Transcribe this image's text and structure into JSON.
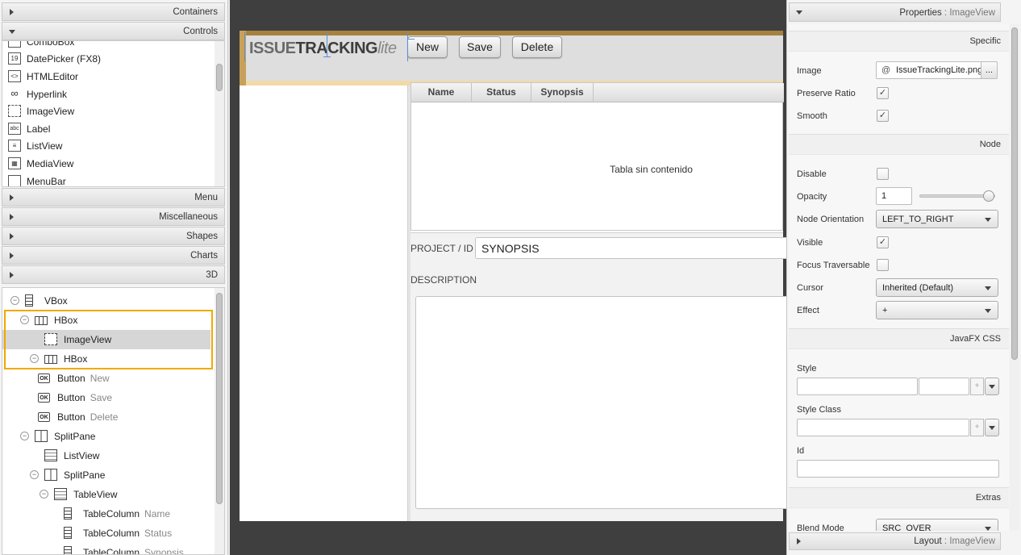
{
  "library": {
    "sections_top": [
      "Containers",
      "Controls"
    ],
    "items": [
      {
        "label": "ComboBox",
        "icon": "combobox-icon"
      },
      {
        "label": "DatePicker  (FX8)",
        "icon": "datepicker-icon",
        "glyph": "19"
      },
      {
        "label": "HTMLEditor",
        "icon": "htmleditor-icon",
        "glyph": "<>"
      },
      {
        "label": "Hyperlink",
        "icon": "hyperlink-icon",
        "glyph": "∞"
      },
      {
        "label": "ImageView",
        "icon": "imageview-icon",
        "glyph": ""
      },
      {
        "label": "Label",
        "icon": "label-icon",
        "glyph": "abc"
      },
      {
        "label": "ListView",
        "icon": "listview-icon",
        "glyph": "≡"
      },
      {
        "label": "MediaView",
        "icon": "mediaview-icon",
        "glyph": "▦"
      },
      {
        "label": "MenuBar",
        "icon": "menubar-icon",
        "glyph": ""
      }
    ],
    "sections_bottom": [
      "Menu",
      "Miscellaneous",
      "Shapes",
      "Charts",
      "3D"
    ]
  },
  "hierarchy": [
    {
      "type": "VBox",
      "sub": "",
      "depth": 0,
      "toggle": "−"
    },
    {
      "type": "HBox",
      "sub": "",
      "depth": 1,
      "toggle": "−"
    },
    {
      "type": "ImageView",
      "sub": "",
      "depth": 2,
      "toggle": ""
    },
    {
      "type": "HBox",
      "sub": "",
      "depth": 2,
      "toggle": "−"
    },
    {
      "type": "Button",
      "sub": "New",
      "depth": 3,
      "toggle": ""
    },
    {
      "type": "Button",
      "sub": "Save",
      "depth": 3,
      "toggle": ""
    },
    {
      "type": "Button",
      "sub": "Delete",
      "depth": 3,
      "toggle": ""
    },
    {
      "type": "SplitPane",
      "sub": "",
      "depth": 1,
      "toggle": "−"
    },
    {
      "type": "ListView",
      "sub": "",
      "depth": 2,
      "toggle": ""
    },
    {
      "type": "SplitPane",
      "sub": "",
      "depth": 2,
      "toggle": "−"
    },
    {
      "type": "TableView",
      "sub": "",
      "depth": 3,
      "toggle": "−"
    },
    {
      "type": "TableColumn",
      "sub": "Name",
      "depth": 4,
      "toggle": ""
    },
    {
      "type": "TableColumn",
      "sub": "Status",
      "depth": 4,
      "toggle": ""
    },
    {
      "type": "TableColumn",
      "sub": "Synopsis",
      "depth": 4,
      "toggle": ""
    }
  ],
  "canvas": {
    "logo": {
      "part1": "ISSUE",
      "part2": "TRACKING",
      "part3": "lite"
    },
    "buttons": [
      "New",
      "Save",
      "Delete"
    ],
    "columns": [
      "Name",
      "Status",
      "Synopsis"
    ],
    "empty_text": "Tabla sin contenido",
    "project_label": "PROJECT / ID",
    "synopsis_value": "SYNOPSIS",
    "description_label": "DESCRIPTION"
  },
  "properties": {
    "header": "Properties",
    "header_sub": " : ImageView",
    "footer": "Layout",
    "footer_sub": " : ImageView",
    "specific": "Specific",
    "image_label": "Image",
    "image_at": "@",
    "image_value": "IssueTrackingLite.png",
    "image_browse": "...",
    "preserve_ratio": "Preserve Ratio",
    "smooth": "Smooth",
    "node": "Node",
    "disable": "Disable",
    "opacity": "Opacity",
    "opacity_value": "1",
    "opacity_level": 1.0,
    "node_orientation": "Node Orientation",
    "node_orientation_value": "LEFT_TO_RIGHT",
    "visible": "Visible",
    "focus_traversable": "Focus Traversable",
    "cursor": "Cursor",
    "cursor_value": "Inherited (Default)",
    "effect": "Effect",
    "effect_value": "+",
    "javafx_css": "JavaFX CSS",
    "style": "Style",
    "style_class": "Style Class",
    "id": "Id",
    "extras": "Extras",
    "blend_mode": "Blend Mode",
    "blend_mode_value": "SRC_OVER",
    "check": "✓"
  }
}
